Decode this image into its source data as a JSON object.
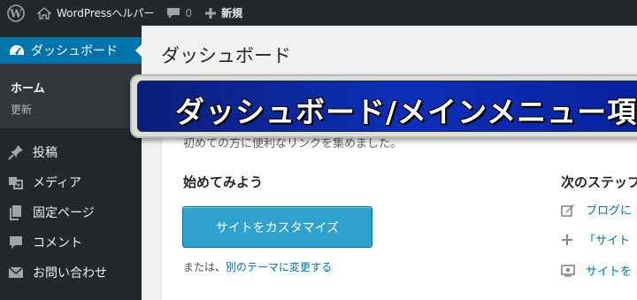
{
  "adminbar": {
    "site_name": "WordPressヘルパー",
    "comments_count": "0",
    "new_label": "新規"
  },
  "sidebar": {
    "dashboard_label": "ダッシュボード",
    "submenu": {
      "home": "ホーム",
      "updates": "更新"
    },
    "items": [
      {
        "label": "投稿",
        "icon": "pushpin-icon"
      },
      {
        "label": "メディア",
        "icon": "media-icon"
      },
      {
        "label": "固定ページ",
        "icon": "pages-icon"
      },
      {
        "label": "コメント",
        "icon": "comment-icon"
      },
      {
        "label": "お問い合わせ",
        "icon": "mail-icon"
      }
    ]
  },
  "main": {
    "page_title": "ダッシュボード",
    "welcome_faded": "初めての方に便利なリンクを集めました。",
    "get_started": "始めてみよう",
    "customize_button": "サイトをカスタマイズ",
    "or_text": "または、",
    "theme_link": "別のテーマに変更する",
    "next_steps": "次のステップ",
    "next_items": [
      "ブログに",
      "「サイト",
      "サイトを"
    ]
  },
  "banner": {
    "text": "ダッシュボード/メインメニュー項目"
  },
  "colors": {
    "adminbar_bg": "#23282d",
    "active_menu": "#0073aa",
    "button": "#2ea2cc",
    "banner_blue": "#0d2fb8"
  }
}
